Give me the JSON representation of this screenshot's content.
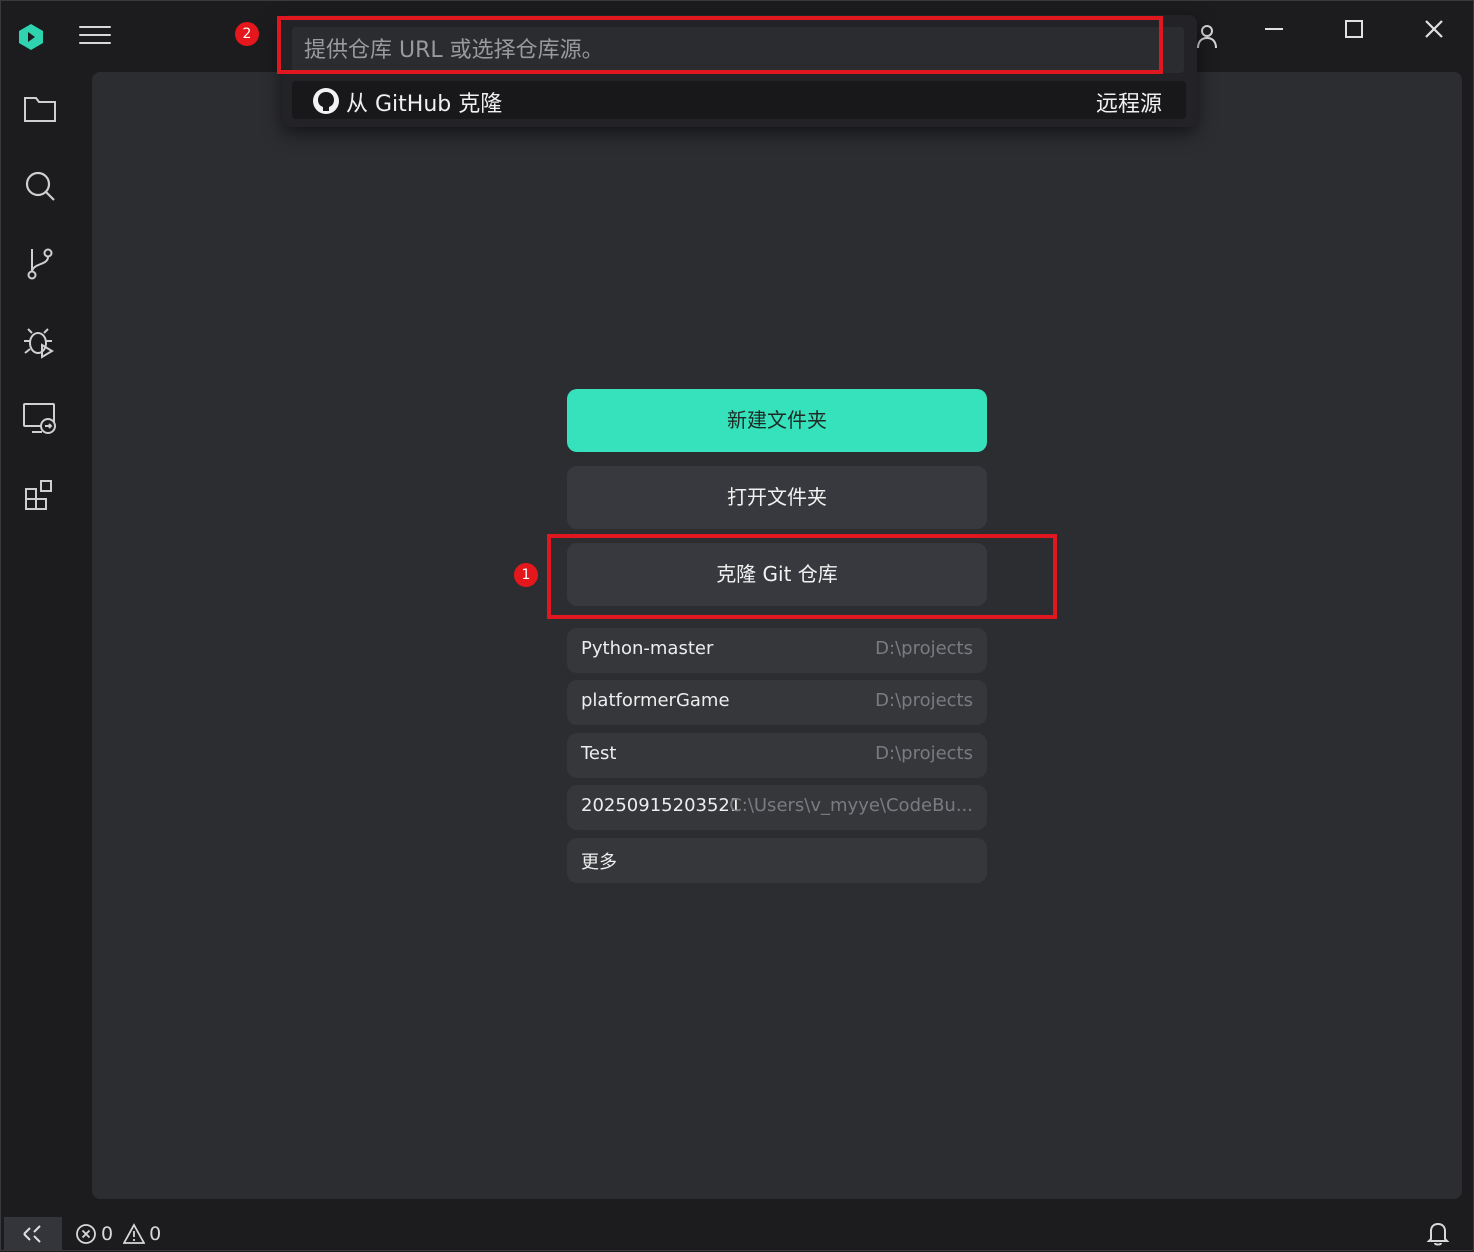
{
  "titlebar": {
    "logo_icon": "codebuddy-logo",
    "menu_icon": "hamburger-menu-icon",
    "account_icon": "account-icon",
    "controls": [
      "minimize-icon",
      "maximize-icon",
      "close-icon"
    ]
  },
  "activity_bar": {
    "items": [
      "explorer-icon",
      "search-icon",
      "source-control-icon",
      "run-debug-icon",
      "remote-explorer-icon",
      "extensions-icon"
    ]
  },
  "quick_pick": {
    "placeholder": "提供仓库 URL 或选择仓库源。",
    "items": [
      {
        "icon": "github-icon",
        "label": "从 GitHub 克隆",
        "description": "远程源"
      }
    ]
  },
  "welcome": {
    "new_folder": "新建文件夹",
    "open_folder": "打开文件夹",
    "clone_repo": "克隆 Git 仓库",
    "recent": [
      {
        "name": "Python-master",
        "path": "D:\\projects"
      },
      {
        "name": "platformerGame",
        "path": "D:\\projects"
      },
      {
        "name": "Test",
        "path": "D:\\projects"
      },
      {
        "name": "20250915203521",
        "path": "C:\\Users\\v_myye\\CodeBu..."
      }
    ],
    "more": "更多"
  },
  "annotations": {
    "badge_1": "1",
    "badge_2": "2",
    "color": "#e0171e"
  },
  "statusbar": {
    "errors": "0",
    "warnings": "0",
    "remote_icon": "remote-indicator-icon",
    "bell_icon": "bell-icon"
  },
  "colors": {
    "accent": "#36e2bb",
    "background": "#1c1c1f",
    "panel": "#2c2d31"
  }
}
